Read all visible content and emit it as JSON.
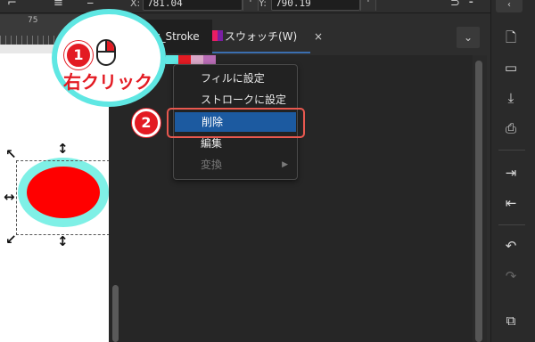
{
  "toolbar": {
    "x_label": "X:",
    "x_value": "781.04",
    "y_label": "Y:",
    "y_value": "790.19",
    "step": "+"
  },
  "ruler": {
    "tick_label": "75"
  },
  "tabs": {
    "active_label": "My_Stroke",
    "swatch_label": "スウォッチ(W)",
    "close_glyph": "×",
    "menu_glyph": "⌄"
  },
  "context_menu": {
    "items": [
      {
        "label": "フィルに設定",
        "state": "normal"
      },
      {
        "label": "ストロークに設定",
        "state": "normal"
      },
      {
        "label": "削除",
        "state": "highlighted"
      },
      {
        "label": "編集",
        "state": "normal"
      },
      {
        "label": "変換",
        "state": "disabled",
        "submenu": true
      }
    ],
    "submenu_glyph": "▶"
  },
  "annotations": {
    "step1": "1",
    "step1_text": "右クリック",
    "step2": "2"
  },
  "swatches": [
    "#5fe7e3",
    "#e31b23",
    "#d9a7c7",
    "#b86cb5",
    "#2b2b2b"
  ],
  "shape": {
    "fill": "#ff0000",
    "stroke": "#7ff0e6"
  },
  "colors": {
    "highlight": "#1c5aa0",
    "badge": "#e31b23",
    "callout": "#5fe7e3"
  },
  "right_toolbar": {
    "icons": [
      "new-document-icon",
      "open-folder-icon",
      "save-icon",
      "print-icon",
      "import-icon",
      "export-icon",
      "undo-icon",
      "redo-icon",
      "duplicate-icon"
    ]
  }
}
